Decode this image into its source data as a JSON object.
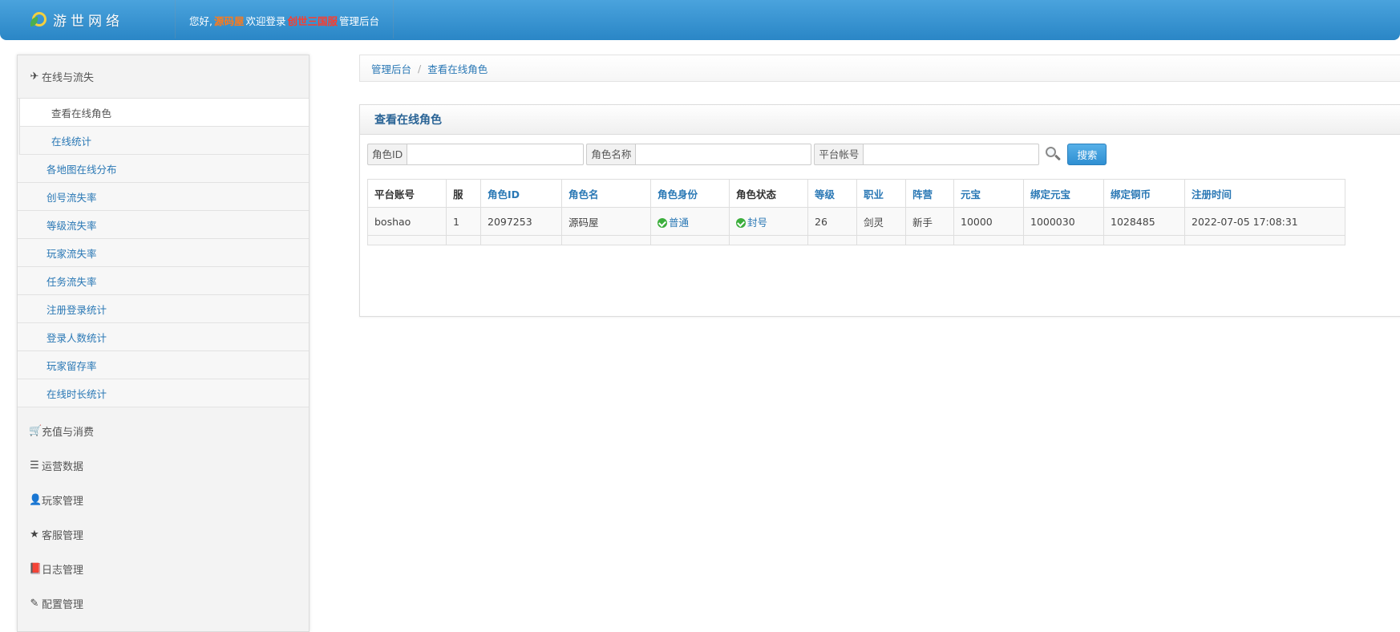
{
  "header": {
    "brand": "游世网络",
    "greeting": "您好,",
    "username": "源码屋",
    "welcome_text": "欢迎登录",
    "game_name": "创世三国",
    "game_suffix": "服",
    "admin_text": "管理后台"
  },
  "sidebar": {
    "sections": [
      {
        "icon": "plane-icon",
        "glyph": "✈",
        "label": "在线与流失",
        "items": [
          "查看在线角色",
          "在线统计",
          "各地图在线分布",
          "创号流失率",
          "等级流失率",
          "玩家流失率",
          "任务流失率",
          "注册登录统计",
          "登录人数统计",
          "玩家留存率",
          "在线时长统计"
        ]
      },
      {
        "icon": "cart-icon",
        "glyph": "🛒",
        "label": "充值与消费"
      },
      {
        "icon": "list-icon",
        "glyph": "☰",
        "label": "运营数据"
      },
      {
        "icon": "user-icon",
        "glyph": "👤",
        "label": "玩家管理"
      },
      {
        "icon": "star-icon",
        "glyph": "★",
        "label": "客服管理"
      },
      {
        "icon": "book-icon",
        "glyph": "📕",
        "label": "日志管理"
      },
      {
        "icon": "edit-icon",
        "glyph": "✎",
        "label": "配置管理"
      }
    ]
  },
  "breadcrumb": {
    "home": "管理后台",
    "separator": "/",
    "current": "查看在线角色"
  },
  "panel": {
    "title": "查看在线角色",
    "search": {
      "role_id_label": "角色ID",
      "role_id_value": "",
      "role_name_label": "角色名称",
      "role_name_value": "",
      "account_label": "平台帐号",
      "account_value": "",
      "button": "搜索"
    },
    "table": {
      "headers": [
        "平台账号",
        "服",
        "角色ID",
        "角色名",
        "角色身份",
        "角色状态",
        "等级",
        "职业",
        "阵营",
        "元宝",
        "绑定元宝",
        "绑定铜币",
        "注册时间"
      ],
      "rows": [
        [
          "boshao",
          "1",
          "2097253",
          "源码屋",
          "普通",
          "封号",
          "26",
          "剑灵",
          "新手",
          "10000",
          "1000030",
          "1028485",
          "2022-07-05 17:08:31"
        ]
      ]
    }
  },
  "colors": {
    "header_top": "#4aa3dd",
    "header_bottom": "#2a86c6",
    "link": "#2a78b5",
    "username": "#ff7a1a",
    "game_name": "#ff3b2b",
    "status_ok": "#3cae3c"
  }
}
